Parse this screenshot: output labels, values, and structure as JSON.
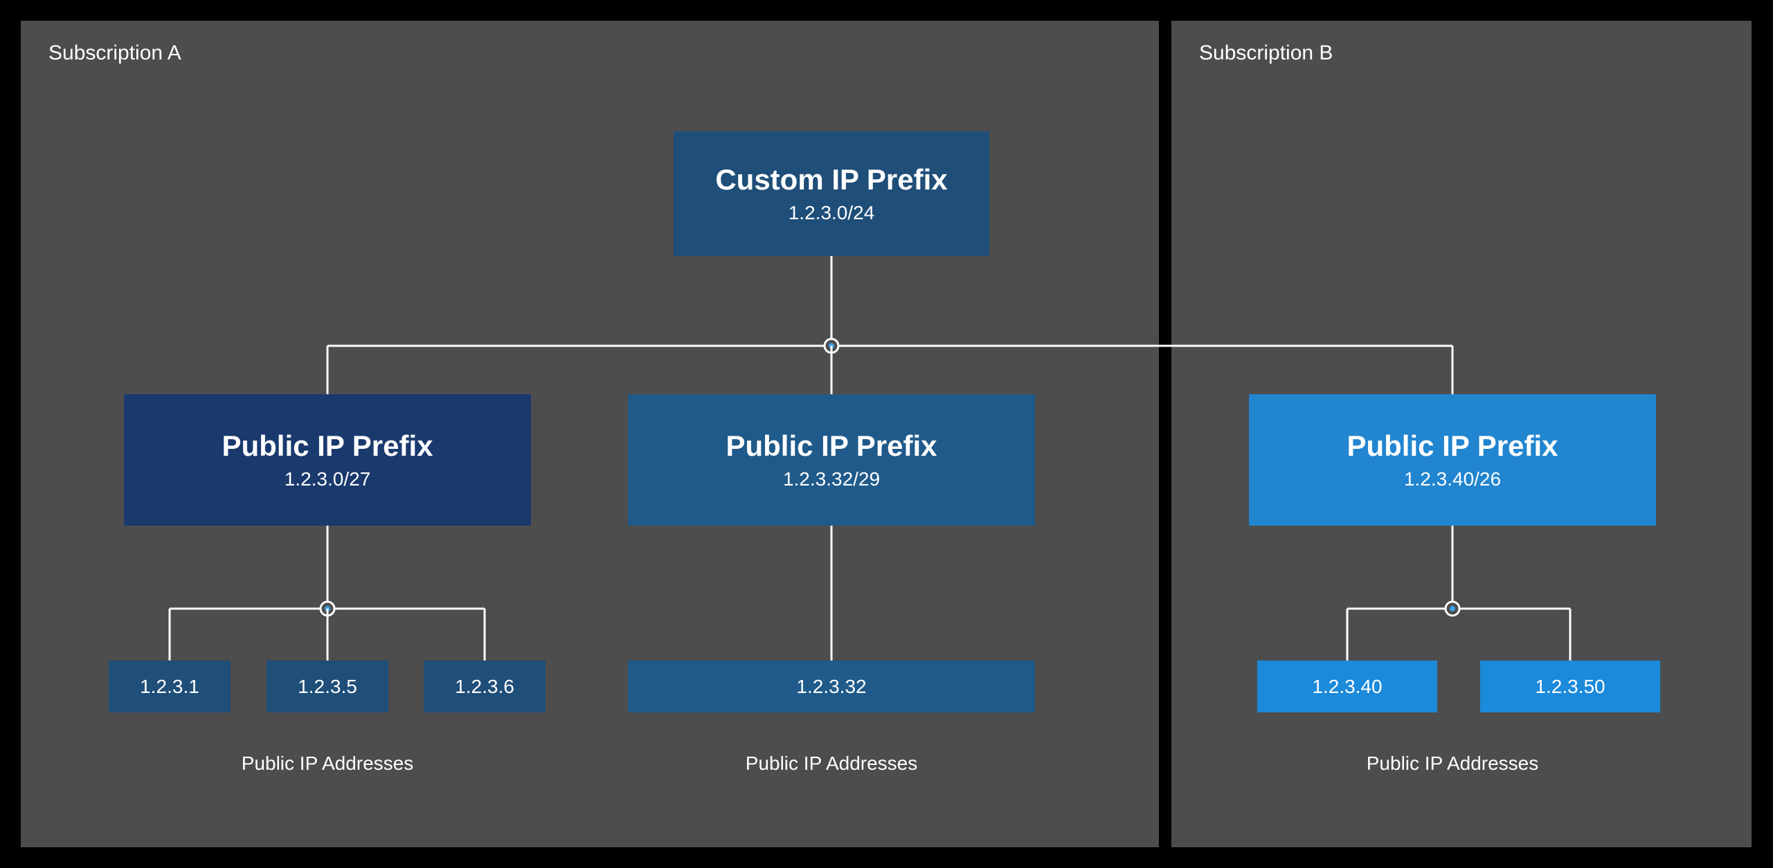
{
  "panels": {
    "a": {
      "label": "Subscription A"
    },
    "b": {
      "label": "Subscription B"
    }
  },
  "custom_prefix": {
    "title": "Custom IP Prefix",
    "range": "1.2.3.0/24"
  },
  "public_prefixes": [
    {
      "title": "Public IP Prefix",
      "range": "1.2.3.0/27"
    },
    {
      "title": "Public IP Prefix",
      "range": "1.2.3.32/29"
    },
    {
      "title": "Public IP Prefix",
      "range": "1.2.3.40/26"
    }
  ],
  "addresses": {
    "group1": [
      "1.2.3.1",
      "1.2.3.5",
      "1.2.3.6"
    ],
    "group2": [
      "1.2.3.32"
    ],
    "group3": [
      "1.2.3.40",
      "1.2.3.50"
    ]
  },
  "labels": {
    "addresses": "Public IP Addresses"
  }
}
